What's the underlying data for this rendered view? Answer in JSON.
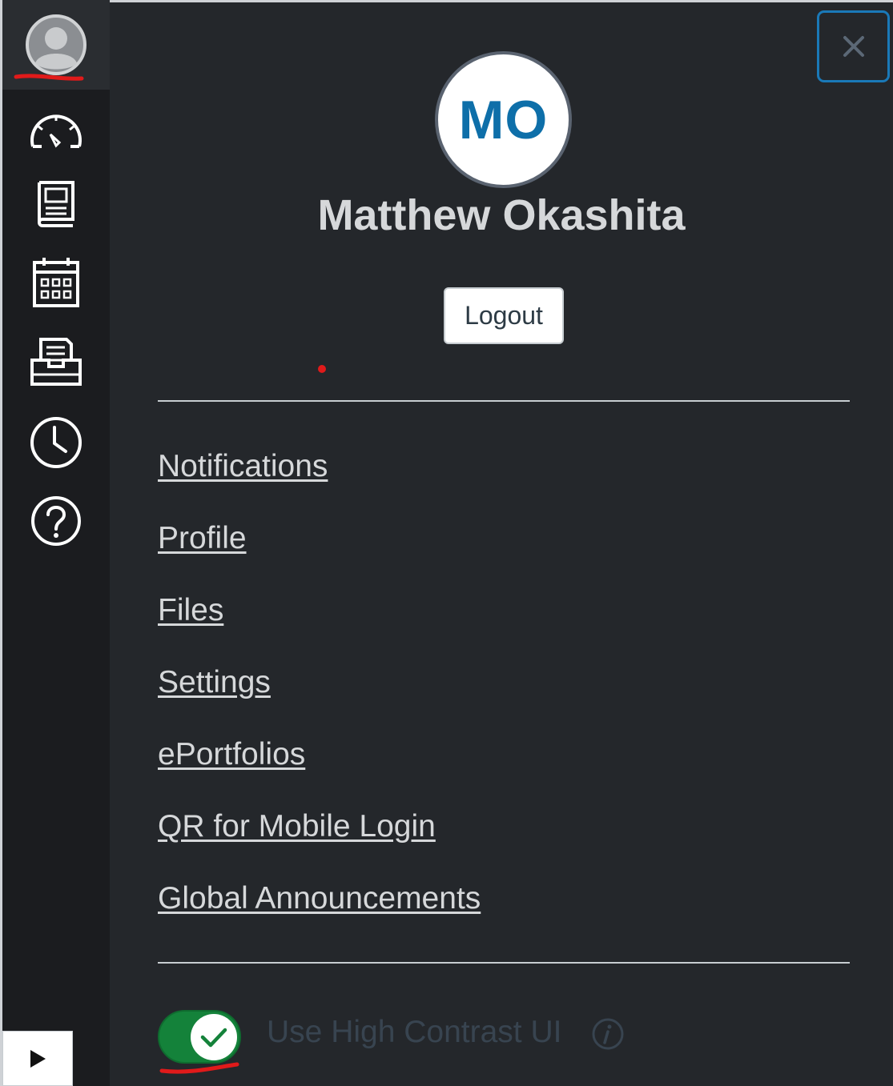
{
  "tray": {
    "avatar_initials": "MO",
    "user_name": "Matthew Okashita",
    "logout_label": "Logout",
    "links": [
      {
        "label": "Notifications"
      },
      {
        "label": "Profile"
      },
      {
        "label": "Files"
      },
      {
        "label": "Settings"
      },
      {
        "label": "ePortfolios"
      },
      {
        "label": "QR for Mobile Login"
      },
      {
        "label": "Global Announcements"
      }
    ],
    "high_contrast": {
      "label": "Use High Contrast UI",
      "enabled": true
    }
  },
  "global_nav": {
    "items": [
      {
        "icon": "account-icon",
        "active": true
      },
      {
        "icon": "dashboard-icon"
      },
      {
        "icon": "courses-icon"
      },
      {
        "icon": "calendar-icon"
      },
      {
        "icon": "inbox-icon"
      },
      {
        "icon": "history-icon"
      },
      {
        "icon": "help-icon"
      }
    ]
  },
  "colors": {
    "accent": "#0e6fa9",
    "toggle_on": "#14823a",
    "annotation": "#e01a1a"
  }
}
